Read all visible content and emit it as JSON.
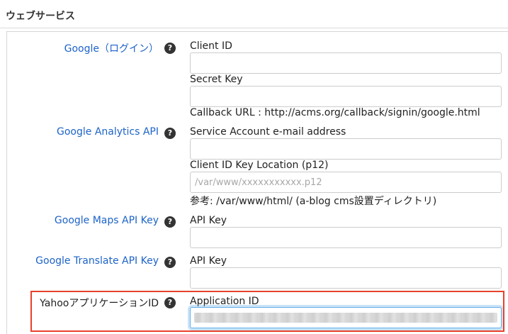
{
  "section": {
    "title": "ウェブサービス"
  },
  "rows": [
    {
      "label": "Google（ログイン）",
      "fields": [
        {
          "label": "Client ID",
          "value": "",
          "placeholder": ""
        },
        {
          "label": "Secret Key",
          "value": "",
          "placeholder": ""
        }
      ],
      "note": "Callback URL : http://acms.org/callback/signin/google.html"
    },
    {
      "label": "Google Analytics API",
      "fields": [
        {
          "label": "Service Account e-mail address",
          "value": "",
          "placeholder": ""
        },
        {
          "label": "Client ID Key Location (p12)",
          "value": "",
          "placeholder": "/var/www/xxxxxxxxxxx.p12"
        }
      ],
      "note": "参考: /var/www/html/ (a-blog cms設置ディレクトリ)"
    },
    {
      "label": "Google Maps API Key",
      "fields": [
        {
          "label": "API Key",
          "value": "",
          "placeholder": ""
        }
      ]
    },
    {
      "label": "Google Translate API Key",
      "fields": [
        {
          "label": "API Key",
          "value": "",
          "placeholder": ""
        }
      ]
    },
    {
      "label": "YahooアプリケーションID",
      "fields": [
        {
          "label": "Application ID",
          "value": "",
          "placeholder": ""
        }
      ]
    }
  ],
  "help_icon": {
    "glyph": "?",
    "name": "question-circle-icon"
  },
  "colors": {
    "link": "#1d63c8",
    "highlight": "#e8412c",
    "focus": "#66afe9"
  }
}
